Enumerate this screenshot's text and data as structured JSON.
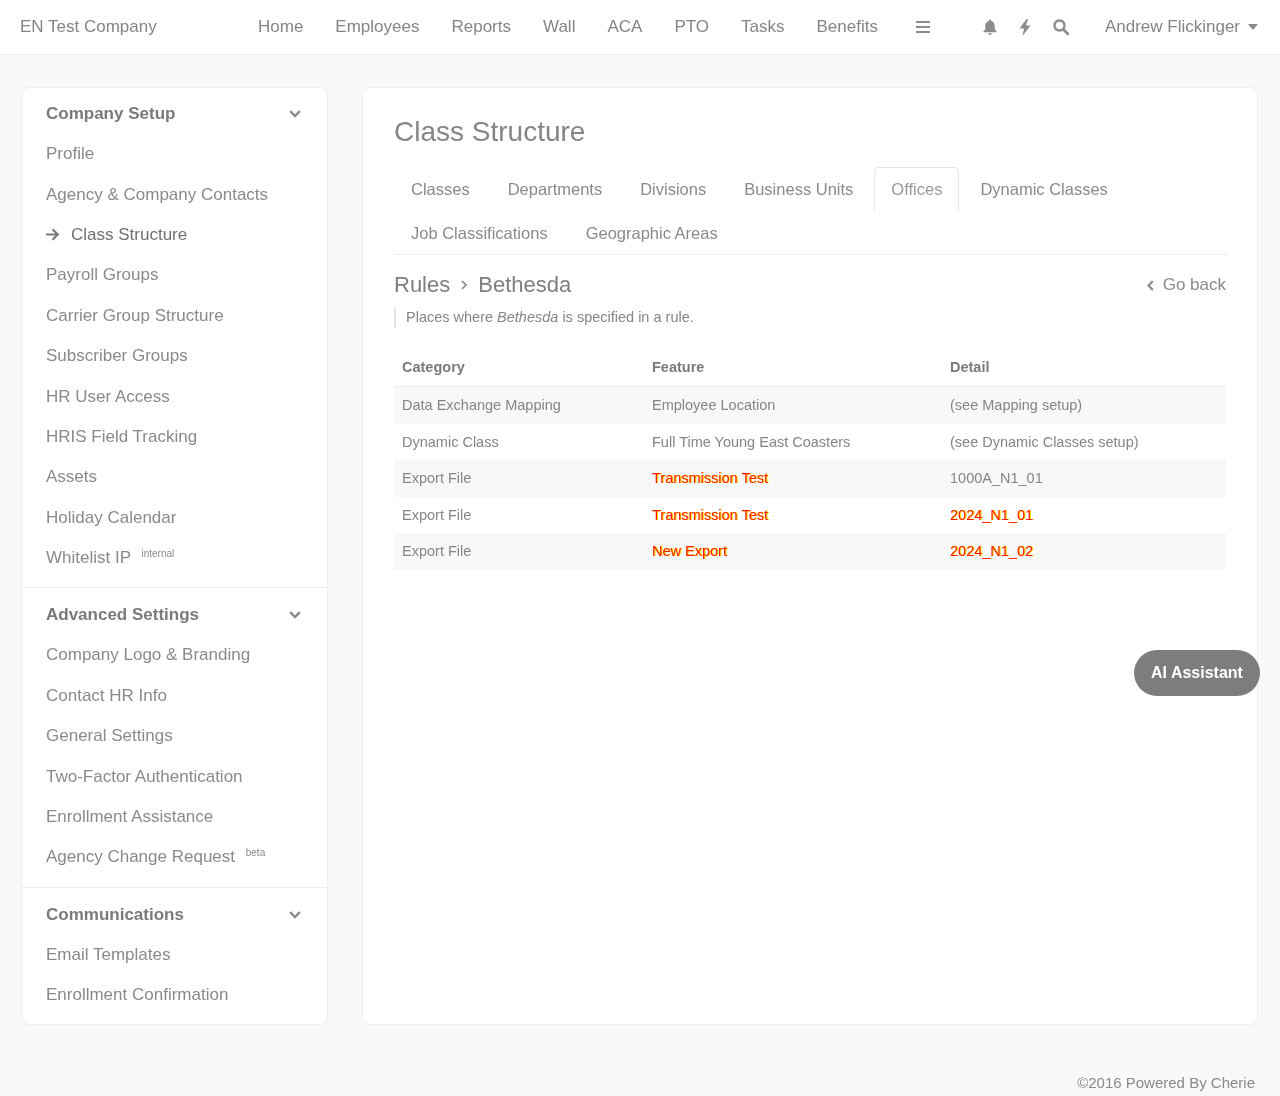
{
  "nav": {
    "brand": "EN Test Company",
    "links": [
      "Home",
      "Employees",
      "Reports",
      "Wall",
      "ACA",
      "PTO",
      "Tasks",
      "Benefits"
    ],
    "user": "Andrew Flickinger"
  },
  "sidebar": {
    "sections": [
      {
        "title": "Company Setup",
        "expanded": true,
        "items": [
          {
            "label": "Profile",
            "selected": false
          },
          {
            "label": "Agency & Company Contacts",
            "selected": false
          },
          {
            "label": "Class Structure",
            "selected": true
          },
          {
            "label": "Payroll Groups",
            "selected": false
          },
          {
            "label": "Carrier Group Structure",
            "selected": false
          },
          {
            "label": "Subscriber Groups",
            "selected": false
          },
          {
            "label": "HR User Access",
            "selected": false
          },
          {
            "label": "HRIS Field Tracking",
            "selected": false
          },
          {
            "label": "Assets",
            "selected": false
          },
          {
            "label": "Holiday Calendar",
            "selected": false
          },
          {
            "label": "Whitelist IP $^{internal}$",
            "selected": false
          }
        ]
      },
      {
        "title": "Advanced Settings",
        "expanded": true,
        "items": [
          {
            "label": "Company Logo & Branding",
            "selected": false
          },
          {
            "label": "Contact HR Info",
            "selected": false
          },
          {
            "label": "General Settings",
            "selected": false
          },
          {
            "label": "Two-Factor Authentication",
            "selected": false
          },
          {
            "label": "Enrollment Assistance",
            "selected": false
          },
          {
            "label": "Agency Change Request $^{beta}$",
            "selected": false
          }
        ]
      },
      {
        "title": "Communications",
        "expanded": true,
        "items": [
          {
            "label": "Email Templates",
            "selected": false
          },
          {
            "label": "Enrollment Confirmation",
            "selected": false
          }
        ]
      }
    ]
  },
  "page": {
    "title": "Class Structure",
    "tabs": [
      {
        "label": "Classes",
        "selected": false
      },
      {
        "label": "Departments",
        "selected": false
      },
      {
        "label": "Divisions",
        "selected": false
      },
      {
        "label": "Business Units",
        "selected": false
      },
      {
        "label": "Offices",
        "selected": true
      },
      {
        "label": "Dynamic Classes",
        "selected": false
      },
      {
        "label": "Job Classifications",
        "selected": false
      },
      {
        "label": "Geographic Areas",
        "selected": false
      }
    ],
    "breadcrumb": {
      "parent": "Rules",
      "current": "Bethesda"
    },
    "back_link": "Go back",
    "note": "Places where *Bethesda* is specified in a rule.",
    "table": {
      "columns": [
        "Category",
        "Feature",
        "Detail"
      ],
      "rows": [
        {
          "cells": [
            {
              "text": "Data Exchange Mapping",
              "garbled": false
            },
            {
              "text": "Employee Location",
              "garbled": false
            },
            {
              "text": "(see Mapping setup)",
              "garbled": false
            }
          ]
        },
        {
          "cells": [
            {
              "text": "Dynamic Class",
              "garbled": false
            },
            {
              "text": "Full Time Young East Coasters",
              "garbled": false
            },
            {
              "text": "(see Dynamic Classes setup)",
              "garbled": false
            }
          ]
        },
        {
          "cells": [
            {
              "text": "Export File",
              "garbled": false
            },
            {
              "text": "Transmission Test",
              "garbled": true
            },
            {
              "text": "1000A_N1_01",
              "garbled": false
            }
          ]
        },
        {
          "cells": [
            {
              "text": "Export File",
              "garbled": false
            },
            {
              "text": "Transmission Test",
              "garbled": true
            },
            {
              "text": "2024_N1_01",
              "garbled": true
            }
          ]
        },
        {
          "cells": [
            {
              "text": "Export File",
              "garbled": false
            },
            {
              "text": "New Export",
              "garbled": true
            },
            {
              "text": "2024_N1_02",
              "garbled": true
            }
          ]
        }
      ]
    }
  },
  "assistant_button": "AI Assistant",
  "footer": "©2016 Powered By Cherie"
}
